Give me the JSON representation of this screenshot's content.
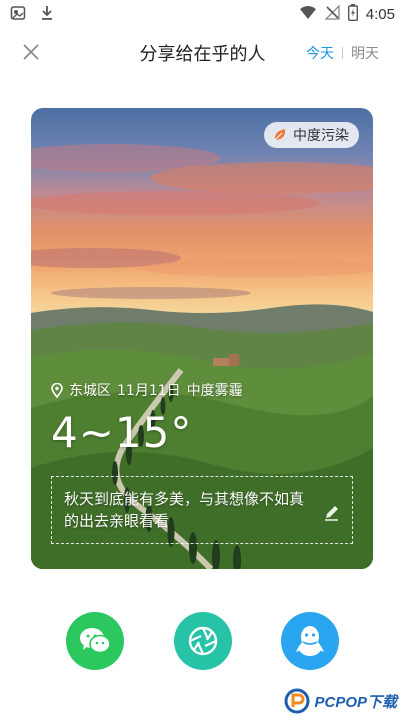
{
  "status_bar": {
    "time": "4:05",
    "left_icons": [
      "gallery-app-icon",
      "download-icon"
    ],
    "right_icons": [
      "wifi-icon",
      "no-signal-icon",
      "battery-icon"
    ]
  },
  "header": {
    "title": "分享给在乎的人",
    "close_icon": "close-icon",
    "tabs": [
      {
        "label": "今天",
        "active": true
      },
      {
        "label": "明天",
        "active": false
      }
    ]
  },
  "card": {
    "badge_label": "中度污染",
    "badge_icon": "leaf-icon",
    "location": "东城区",
    "date": "11月11日",
    "condition": "中度雾霾",
    "temperature": "4~15°",
    "quote": "秋天到底能有多美，与其想像不如真的出去亲眼看看",
    "edit_icon": "pencil-icon"
  },
  "share": {
    "buttons": [
      {
        "id": "wechat",
        "icon": "wechat-icon",
        "color": "#2dc760"
      },
      {
        "id": "moments",
        "icon": "moments-shutter-icon",
        "color": "#26c3a7"
      },
      {
        "id": "qq",
        "icon": "qq-penguin-icon",
        "color": "#2aa6f0"
      }
    ]
  },
  "watermark": {
    "text": "PCPOP下载"
  },
  "colors": {
    "accent": "#1a98e6",
    "badge_icon": "#f07a3c"
  }
}
